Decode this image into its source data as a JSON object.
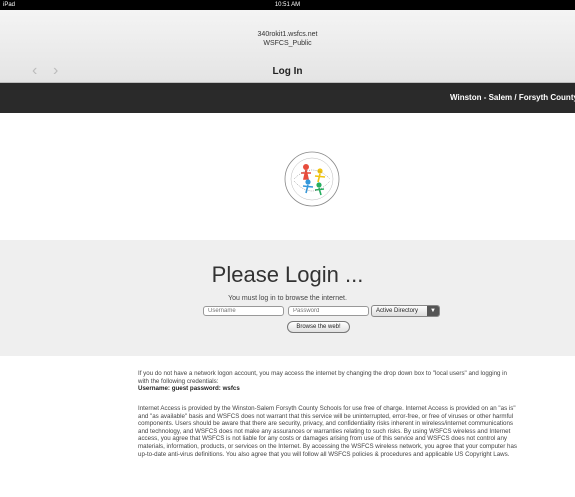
{
  "status_bar": {
    "carrier": "iPad",
    "time": "10:51 AM",
    "battery": ""
  },
  "browser": {
    "url": "340rokit1.wsfcs.net",
    "network": "WSFCS_Public",
    "page_title": "Log In",
    "back_icon": "chevron-left-icon",
    "forward_icon": "chevron-right-icon"
  },
  "banner": {
    "text": "Winston - Salem / Forsyth County Schools"
  },
  "login": {
    "heading": "Please Login ...",
    "subtext": "You must log in to browse the internet.",
    "username_placeholder": "Username",
    "password_placeholder": "Password",
    "auth_select_value": "Active Directory",
    "browse_button": "Browse the web!"
  },
  "info": {
    "guest_note": "If you do not have a network logon account, you may access the internet by changing the drop down box to \"local users\" and logging in with the following credentials:",
    "credentials": "Username: guest password: wsfcs",
    "disclaimer": "Internet Access is provided by the Winston-Salem Forsyth County Schools for use free of charge. Internet Access is provided on an \"as is\" and \"as available\" basis and WSFCS does not warrant that this service will be uninterrupted, error-free, or free of viruses or other harmful components. Users should be aware that there are security, privacy, and confidentiality risks inherent in wireless/internet communications and technology, and WSFCS does not make any assurances or warranties relating to such risks. By using WSFCS wireless and Internet access, you agree that WSFCS is not liable for any costs or damages arising from use of this service and WSFCS does not control any materials, information, products, or services on the Internet. By accessing the WSFCS wireless network, you agree that your computer has up-to-date anti-virus definitions. You also agree that you will follow all WSFCS policies & procedures and applicable US Copyright Laws."
  }
}
